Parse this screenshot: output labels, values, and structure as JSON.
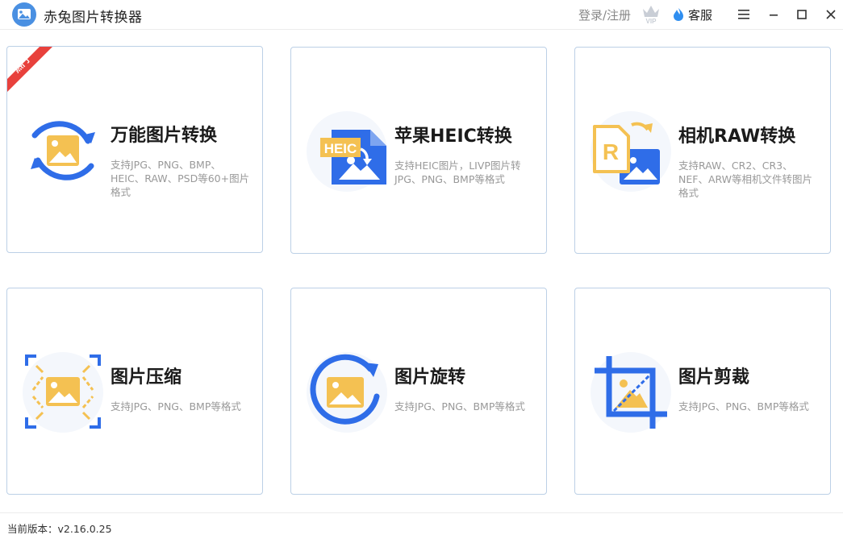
{
  "app": {
    "title": "赤兔图片转换器"
  },
  "header": {
    "login_label": "登录/注册",
    "vip_label": "VIP",
    "service_label": "客服"
  },
  "cards": [
    {
      "title": "万能图片转换",
      "desc": "支持JPG、PNG、BMP、HEIC、RAW、PSD等60+图片格式",
      "badge": "热门"
    },
    {
      "title": "苹果HEIC转换",
      "desc": "支持HEIC图片，LIVP图片转JPG、PNG、BMP等格式",
      "icon_text": "HEIC"
    },
    {
      "title": "相机RAW转换",
      "desc": "支持RAW、CR2、CR3、NEF、ARW等相机文件转图片格式",
      "icon_text": "R"
    },
    {
      "title": "图片压缩",
      "desc": "支持JPG、PNG、BMP等格式"
    },
    {
      "title": "图片旋转",
      "desc": "支持JPG、PNG、BMP等格式"
    },
    {
      "title": "图片剪裁",
      "desc": "支持JPG、PNG、BMP等格式"
    }
  ],
  "footer": {
    "version": "当前版本：v2.16.0.25"
  },
  "colors": {
    "blue": "#2f6de8",
    "yellow": "#f4c152",
    "red": "#e8413c",
    "border": "#bcd0e6"
  },
  "icons": [
    "app-logo-icon",
    "vip-crown-icon",
    "service-flame-icon",
    "menu-icon",
    "minimize-icon",
    "maximize-icon",
    "close-icon"
  ]
}
